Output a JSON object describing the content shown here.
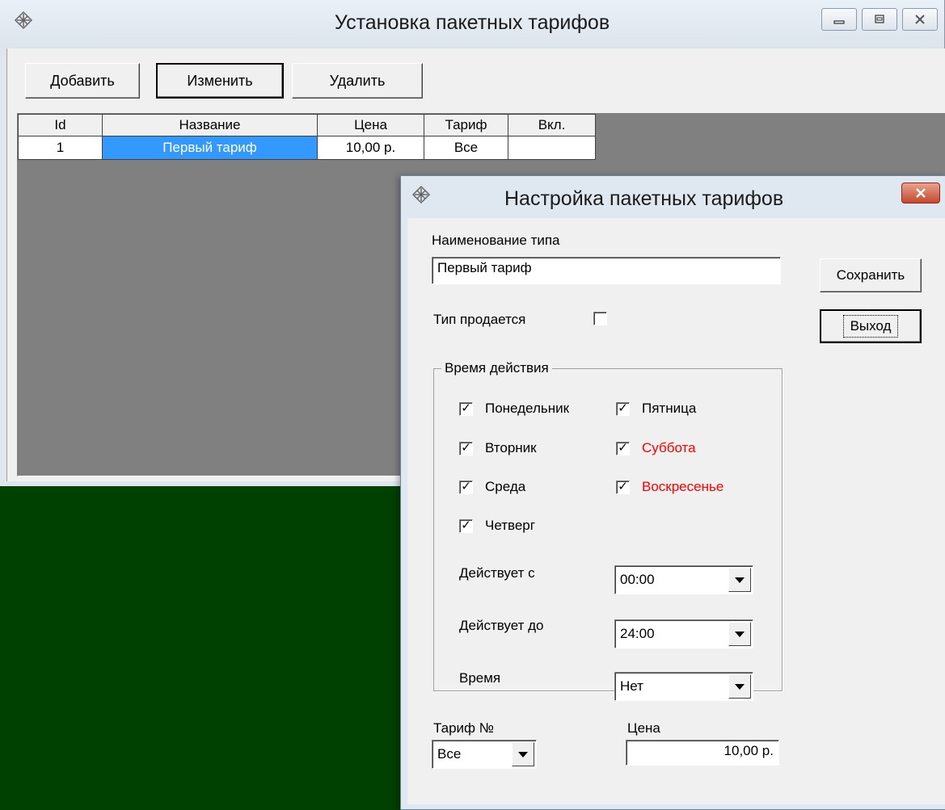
{
  "main_window": {
    "title": "Установка пакетных тарифов",
    "toolbar": {
      "add_label": "Добавить",
      "edit_label": "Изменить",
      "delete_label": "Удалить"
    },
    "table": {
      "columns": [
        "Id",
        "Название",
        "Цена",
        "Тариф",
        "Вкл."
      ],
      "rows": [
        {
          "id": "1",
          "name": "Первый тариф",
          "price": "10,00 р.",
          "tariff": "Все",
          "enabled": ""
        }
      ]
    }
  },
  "dialog": {
    "title": "Настройка пакетных тарифов",
    "type_name_label": "Наименование типа",
    "type_name_value": "Первый тариф",
    "save_label": "Сохранить",
    "exit_label": "Выход",
    "sold_label": "Тип  продается",
    "sold_checked": false,
    "validity_group_label": "Время действия",
    "days": {
      "monday": {
        "label": "Понедельник",
        "checked": true
      },
      "tuesday": {
        "label": "Вторник",
        "checked": true
      },
      "wednesday": {
        "label": "Среда",
        "checked": true
      },
      "thursday": {
        "label": "Четверг",
        "checked": true
      },
      "friday": {
        "label": "Пятница",
        "checked": true
      },
      "saturday": {
        "label": "Суббота",
        "checked": true
      },
      "sunday": {
        "label": "Воскресенье",
        "checked": true
      }
    },
    "weekend_color": "#ff0000",
    "valid_from_label": "Действует с",
    "valid_from_value": "00:00",
    "valid_to_label": "Действует до",
    "valid_to_value": "24:00",
    "time_label": "Время",
    "time_value": "Нет",
    "tariff_no_label": "Тариф №",
    "tariff_no_value": "Все",
    "price_label": "Цена",
    "price_value": "10,00 р."
  },
  "colors": {
    "desktop_background": "#004000",
    "selection": "#3399ff",
    "grid_background": "#808080"
  }
}
